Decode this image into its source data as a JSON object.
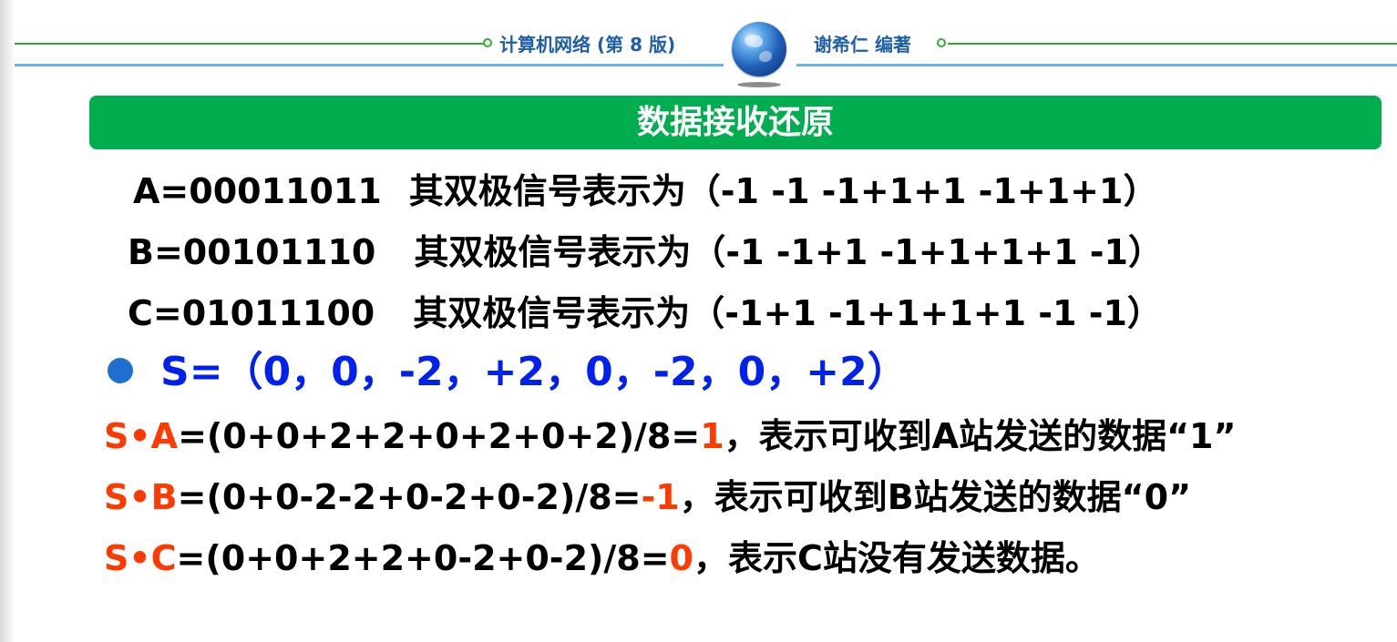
{
  "header": {
    "book_title": "计算机网络 (第 8 版)",
    "author": "谢希仁 编著"
  },
  "slide": {
    "title": "数据接收还原",
    "codes": [
      {
        "label": "A=00011011",
        "desc": "其双极信号表示为（-1 -1 -1+1+1 -1+1+1）"
      },
      {
        "label": "B=00101110",
        "desc": "其双极信号表示为（-1 -1+1 -1+1+1+1 -1）"
      },
      {
        "label": "C=01011100",
        "desc": "其双极信号表示为（-1+1 -1+1+1+1 -1 -1）"
      }
    ],
    "s_vector": "S=（0，0，-2，+2，0，-2，0，+2）",
    "results": [
      {
        "prefix": "S•A",
        "formula": "=(0+0+2+2+0+2+0+2)/8=",
        "value": "1",
        "text": "，表示可收到A站发送的数据“1”"
      },
      {
        "prefix": "S•B",
        "formula": "=(0+0-2-2+0-2+0-2)/8=",
        "value": "-1",
        "text": "，表示可收到B站发送的数据“0”"
      },
      {
        "prefix": "S•C",
        "formula": "=(0+0+2+2+0-2+0-2)/8=",
        "value": "0",
        "text": "，表示C站没有发送数据。"
      }
    ]
  },
  "colors": {
    "banner": "#00ae4f",
    "accent_red": "#ff3a00",
    "vector_blue": "#0020f0",
    "header_blue": "#1f5fa8"
  }
}
